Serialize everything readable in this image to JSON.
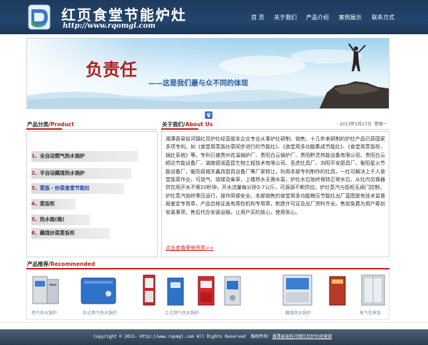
{
  "header": {
    "title": "红页食堂节能炉灶",
    "url": "http://www.rqomgl.com",
    "nav": [
      "首 页",
      "关于我们",
      "产品介绍",
      "案例展示",
      "联系方式"
    ]
  },
  "banner": {
    "slogan": "负责任",
    "tagline": "——这是我们最与众不同的体现"
  },
  "categories": {
    "heading": "产品分类/",
    "heading_en": "Product",
    "items": [
      {
        "num": "1、",
        "label": "全自动燃气热水锅炉"
      },
      {
        "num": "2、",
        "label": "半自动藕煤热水锅炉"
      },
      {
        "num": "3、",
        "label": "蒸饭・炒菜食堂节能灶"
      },
      {
        "num": "4、",
        "label": "蒸饭柜"
      },
      {
        "num": "5、",
        "label": "热水箱(桶)"
      },
      {
        "num": "6、",
        "label": "藕煤炒菜蒸饭柜"
      }
    ]
  },
  "about": {
    "heading": "关于我们/",
    "heading_en": "About Us",
    "date": "2013年5月27日",
    "weekday": "星期一",
    "body": "湘潭县易俗河镇红页炉灶经营部本企业专业从事炉灶研制、销售。十几年来研制的炉灶产品已获国家多项专利。如《食堂用蒸饭炒菜同步进行的节能灶》、《食堂用多功能集成节能灶》、《食堂用蒸饭柜、锅灶系统》等。专利已被贵州花溪锅炉厂、贵阳白云锅炉厂、贵阳黔灵热能设备有限公司、贵阳白云顺达节能设备厂、湖南德润蓝昆生物工程技术有限公司、圣虎灶具厂、浏阳平安厨具厂、衡阳星火节能设备厂、衡阳县城关鑫孜厨具设备厂等厂家转让，利用本部专利制作的灶具，一灶可解决上千人食堂饭菜作业，可烧气、烧煤及柴草，上楼热水无需水泵，炉灶水位始终保持正常水位，从灶内交换器供饮用开水不需20秒钟，开水流量每分钟3-7公斤，可源源不断供应。炉灶蒸汽与饭柜无阀门控制，炉灶蒸汽始终零压运行，操作简便安全。本部销售的食堂用多功能粮压节能灶出厂蓝图是有技术监督局鉴定专用章，产品合格证盖有质检机构专用章，制造许可证及出厂资料齐全。售前免费为用户筹划安装事项，售后代办安装运输，让用户买的放心，使用安心。",
    "more": "点击查看荣誉资质>>"
  },
  "recommended": {
    "heading": "产品推荐/",
    "heading_en": "Recommended",
    "products": [
      {
        "caption": "燃气热水锅炉"
      },
      {
        "caption": "卧式燃气热水锅炉"
      },
      {
        "caption": ""
      },
      {
        "caption": "立式燃气热水锅炉"
      },
      {
        "caption": ""
      },
      {
        "caption": ""
      },
      {
        "caption": "藕煤热水锅炉"
      },
      {
        "caption": ""
      },
      {
        "caption": "蒸气型蒸饭"
      }
    ]
  },
  "footer": {
    "copyright": "Copyright © 2013- Http://www.rqomgl.com All Rights Reserved",
    "owner_label": "版权所有：",
    "owner_name": "湘潭县易俗河镇红页炉灶经营部"
  },
  "colors": {
    "header_bg": "#24456c",
    "accent_red": "#c01e1e",
    "active_blue": "#1e40b0",
    "footer_bg": "#3a4b60"
  }
}
